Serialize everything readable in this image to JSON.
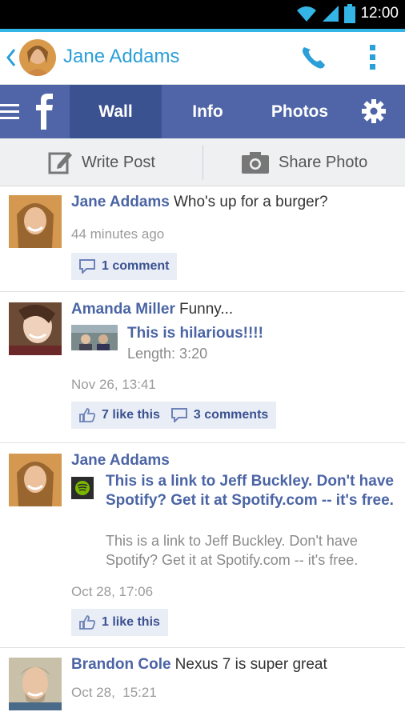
{
  "status": {
    "time": "12:00"
  },
  "header": {
    "title": "Jane Addams"
  },
  "nav": {
    "tabs": [
      {
        "label": "Wall",
        "active": true
      },
      {
        "label": "Info"
      },
      {
        "label": "Photos"
      }
    ]
  },
  "actions": {
    "write_post": "Write Post",
    "share_photo": "Share Photo"
  },
  "posts": [
    {
      "name": "Jane Addams",
      "message": "Who's up for a burger?",
      "time": "44 minutes ago",
      "comments": "1 comment"
    },
    {
      "name": "Amanda Miller",
      "message": "Funny...",
      "link_title": "This is hilarious!!!!",
      "length": "Length: 3:20",
      "time": "Nov 26, 13:41",
      "likes": "7 like this",
      "comments": "3 comments"
    },
    {
      "name": "Jane Addams",
      "link_title": "This is a link to Jeff Buckley. Don't have Spotify? Get it at Spotify.com -- it's free.",
      "link_desc": "This is a link to Jeff Buckley. Don't have Spotify? Get it at Spotify.com -- it's free.",
      "time": "Oct 28, 17:06",
      "likes": "1 like this"
    },
    {
      "name": "Brandon Cole",
      "message": "Nexus 7 is super great",
      "time": "Oct 28,  15:21"
    }
  ],
  "colors": {
    "accent": "#33b5e5",
    "facebook_blue": "#4f65a7",
    "facebook_dark": "#3b5291",
    "title_blue": "#2a9fd8"
  },
  "icons": [
    "wifi-icon",
    "signal-icon",
    "battery-icon",
    "back-chevron-icon",
    "phone-icon",
    "overflow-menu-icon",
    "hamburger-icon",
    "facebook-logo-icon",
    "gear-icon",
    "edit-icon",
    "camera-icon",
    "comment-icon",
    "like-icon",
    "spotify-icon"
  ]
}
